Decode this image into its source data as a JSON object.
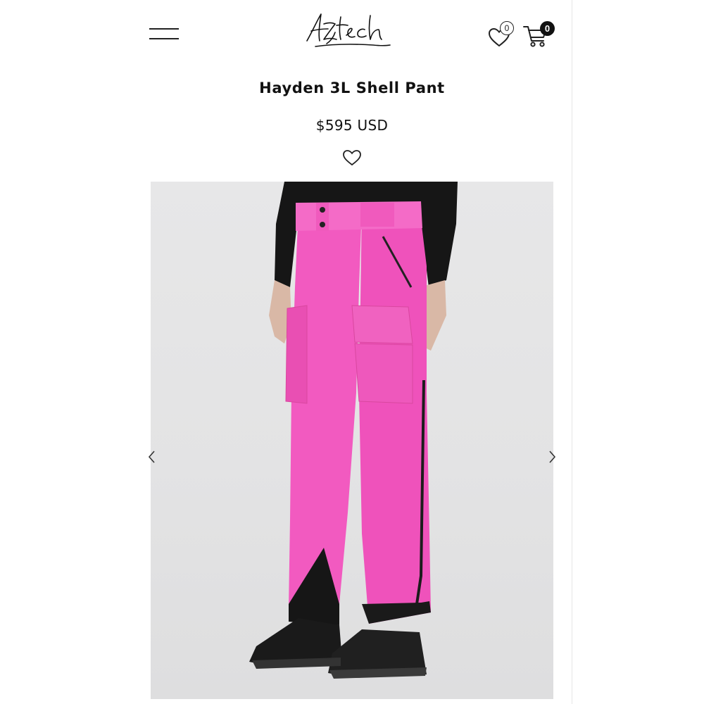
{
  "header": {
    "brand": "Aztech",
    "wishlist_count": "0",
    "cart_count": "0"
  },
  "product": {
    "title": "Hayden 3L Shell Pant",
    "price": "$595 USD",
    "image_description_color": "#f25ac0"
  },
  "icons": {
    "menu": "hamburger-menu-icon",
    "wishlist": "heart-icon",
    "cart": "shopping-cart-icon",
    "favorite": "heart-outline-icon",
    "prev": "chevron-left-icon",
    "next": "chevron-right-icon"
  },
  "colors": {
    "accent": "#111111",
    "product_pink": "#f25ac0",
    "background": "#ffffff"
  }
}
